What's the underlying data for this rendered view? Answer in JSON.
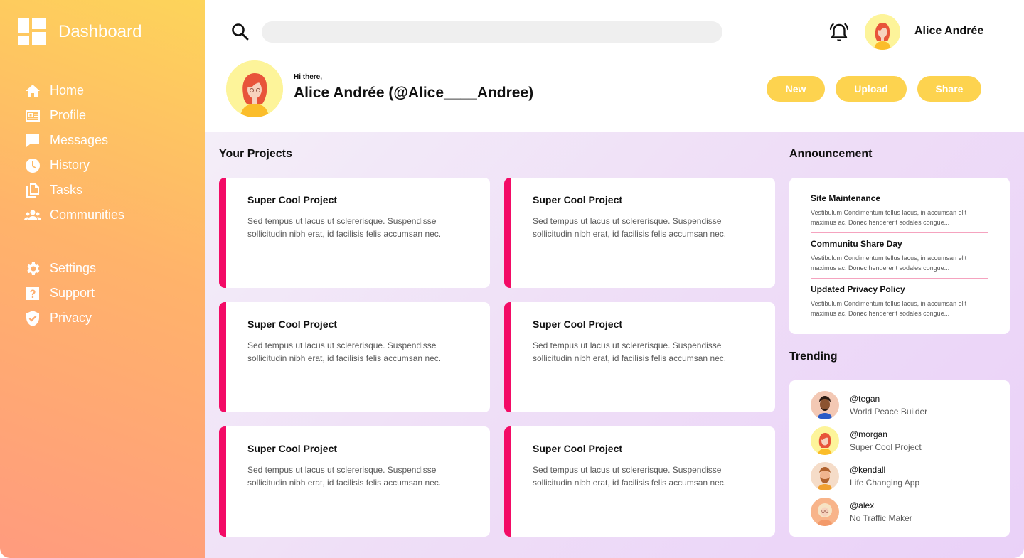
{
  "brand": {
    "title": "Dashboard"
  },
  "sidebar": {
    "main": [
      {
        "label": "Home",
        "icon": "home-icon"
      },
      {
        "label": "Profile",
        "icon": "id-card-icon"
      },
      {
        "label": "Messages",
        "icon": "message-icon"
      },
      {
        "label": "History",
        "icon": "clock-icon"
      },
      {
        "label": "Tasks",
        "icon": "documents-icon"
      },
      {
        "label": "Communities",
        "icon": "users-icon"
      }
    ],
    "secondary": [
      {
        "label": "Settings",
        "icon": "gear-icon"
      },
      {
        "label": "Support",
        "icon": "help-icon"
      },
      {
        "label": "Privacy",
        "icon": "shield-check-icon"
      }
    ]
  },
  "header": {
    "search_placeholder": "",
    "user_name": "Alice Andrée",
    "greeting": "Hi there,",
    "profile_name": "Alice Andrée (@Alice____Andree)",
    "buttons": {
      "new": "New",
      "upload": "Upload",
      "share": "Share"
    }
  },
  "projects": {
    "title": "Your Projects",
    "items": [
      {
        "title": "Super Cool Project",
        "description": "Sed tempus ut lacus ut sclererisque. Suspendisse sollicitudin nibh erat, id facilisis felis accumsan nec."
      },
      {
        "title": "Super Cool Project",
        "description": "Sed tempus ut lacus ut sclererisque. Suspendisse sollicitudin nibh erat, id facilisis felis accumsan nec."
      },
      {
        "title": "Super Cool Project",
        "description": "Sed tempus ut lacus ut sclererisque. Suspendisse sollicitudin nibh erat, id facilisis felis accumsan nec."
      },
      {
        "title": "Super Cool Project",
        "description": "Sed tempus ut lacus ut sclererisque. Suspendisse sollicitudin nibh erat, id facilisis felis accumsan nec."
      },
      {
        "title": "Super Cool Project",
        "description": "Sed tempus ut lacus ut sclererisque. Suspendisse sollicitudin nibh erat, id facilisis felis accumsan nec."
      },
      {
        "title": "Super Cool Project",
        "description": "Sed tempus ut lacus ut sclererisque. Suspendisse sollicitudin nibh erat, id facilisis felis accumsan nec."
      }
    ]
  },
  "announcements": {
    "title": "Announcement",
    "items": [
      {
        "title": "Site Maintenance",
        "text": "Vestibulum Condimentum tellus lacus, in accumsan elit maximus ac. Donec hendererit sodales congue..."
      },
      {
        "title": "Communitu Share Day",
        "text": "Vestibulum Condimentum tellus lacus, in accumsan elit maximus ac. Donec hendererit sodales congue..."
      },
      {
        "title": "Updated Privacy Policy",
        "text": "Vestibulum Condimentum tellus lacus, in accumsan elit maximus ac. Donec hendererit sodales congue..."
      }
    ]
  },
  "trending": {
    "title": "Trending",
    "items": [
      {
        "handle": "@tegan",
        "role": "World Peace Builder"
      },
      {
        "handle": "@morgan",
        "role": "Super Cool Project"
      },
      {
        "handle": "@kendall",
        "role": "Life Changing App"
      },
      {
        "handle": "@alex",
        "role": "No Traffic Maker"
      }
    ]
  },
  "colors": {
    "accent_button": "#fdd34f",
    "card_stripe": "#f30b66",
    "sidebar_top": "#fdd45a",
    "sidebar_bottom": "#ff9b7e"
  }
}
